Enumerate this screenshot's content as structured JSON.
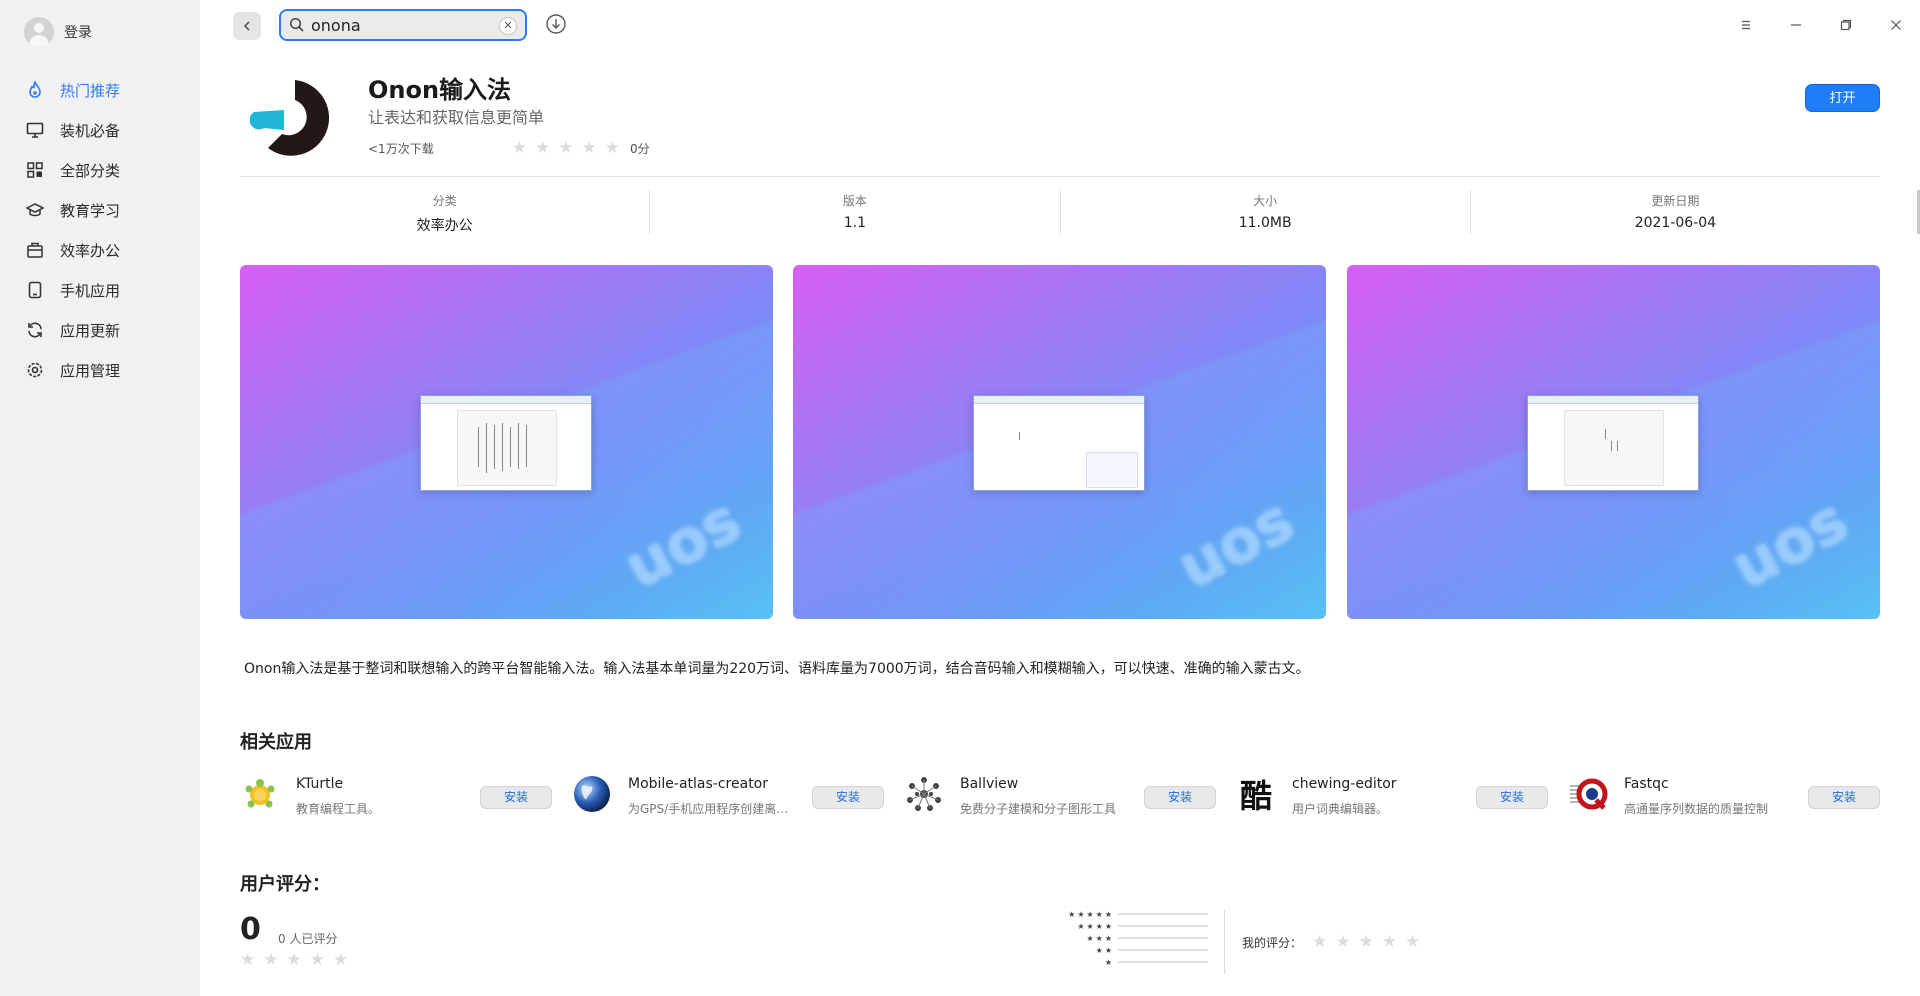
{
  "sidebar": {
    "login_label": "登录",
    "items": [
      {
        "label": "热门推荐",
        "icon": "fire-icon",
        "active": true
      },
      {
        "label": "装机必备",
        "icon": "monitor-icon"
      },
      {
        "label": "全部分类",
        "icon": "grid-icon"
      },
      {
        "label": "教育学习",
        "icon": "graduation-cap-icon"
      },
      {
        "label": "效率办公",
        "icon": "briefcase-icon"
      },
      {
        "label": "手机应用",
        "icon": "phone-icon"
      },
      {
        "label": "应用更新",
        "icon": "refresh-icon"
      },
      {
        "label": "应用管理",
        "icon": "gear-icon"
      }
    ]
  },
  "search": {
    "value": "onona"
  },
  "app": {
    "name": "Onon输入法",
    "tagline": "让表达和获取信息更简单",
    "downloads": "<1万次下载",
    "rating": "0分",
    "stars": 0,
    "open_label": "打开"
  },
  "info": [
    {
      "key": "分类",
      "value": "效率办公"
    },
    {
      "key": "版本",
      "value": "1.1"
    },
    {
      "key": "大小",
      "value": "11.0MB"
    },
    {
      "key": "更新日期",
      "value": "2021-06-04"
    }
  ],
  "description": "Onon输入法是基于整词和联想输入的跨平台智能输入法。输入法基本单词量为220万词、语料库量为7000万词，结合音码输入和模糊输入，可以快速、准确的输入蒙古文。",
  "related": {
    "title": "相关应用",
    "install_label": "安装",
    "apps": [
      {
        "name": "KTurtle",
        "desc": "教育编程工具。",
        "icon": "turtle-icon"
      },
      {
        "name": "Mobile-atlas-creator",
        "desc": "为GPS/手机应用程序创建离线地图集",
        "icon": "globe-icon"
      },
      {
        "name": "Ballview",
        "desc": "免费分子建模和分子图形工具",
        "icon": "molecule-icon"
      },
      {
        "name": "chewing-editor",
        "desc": "用户词典编辑器。",
        "icon": "chinese-character-icon",
        "glyph": "酷"
      },
      {
        "name": "Fastqc",
        "desc": "高通量序列数据的质量控制",
        "icon": "fastqc-icon"
      }
    ]
  },
  "ratings": {
    "title": "用户评分：",
    "score": "0",
    "count": "0 人已评分",
    "my_rating_label": "我的评分："
  },
  "colors": {
    "accent": "#2e7bf6",
    "sidebar_bg": "#f1f1f1",
    "open_button": "#1f7ef7"
  }
}
